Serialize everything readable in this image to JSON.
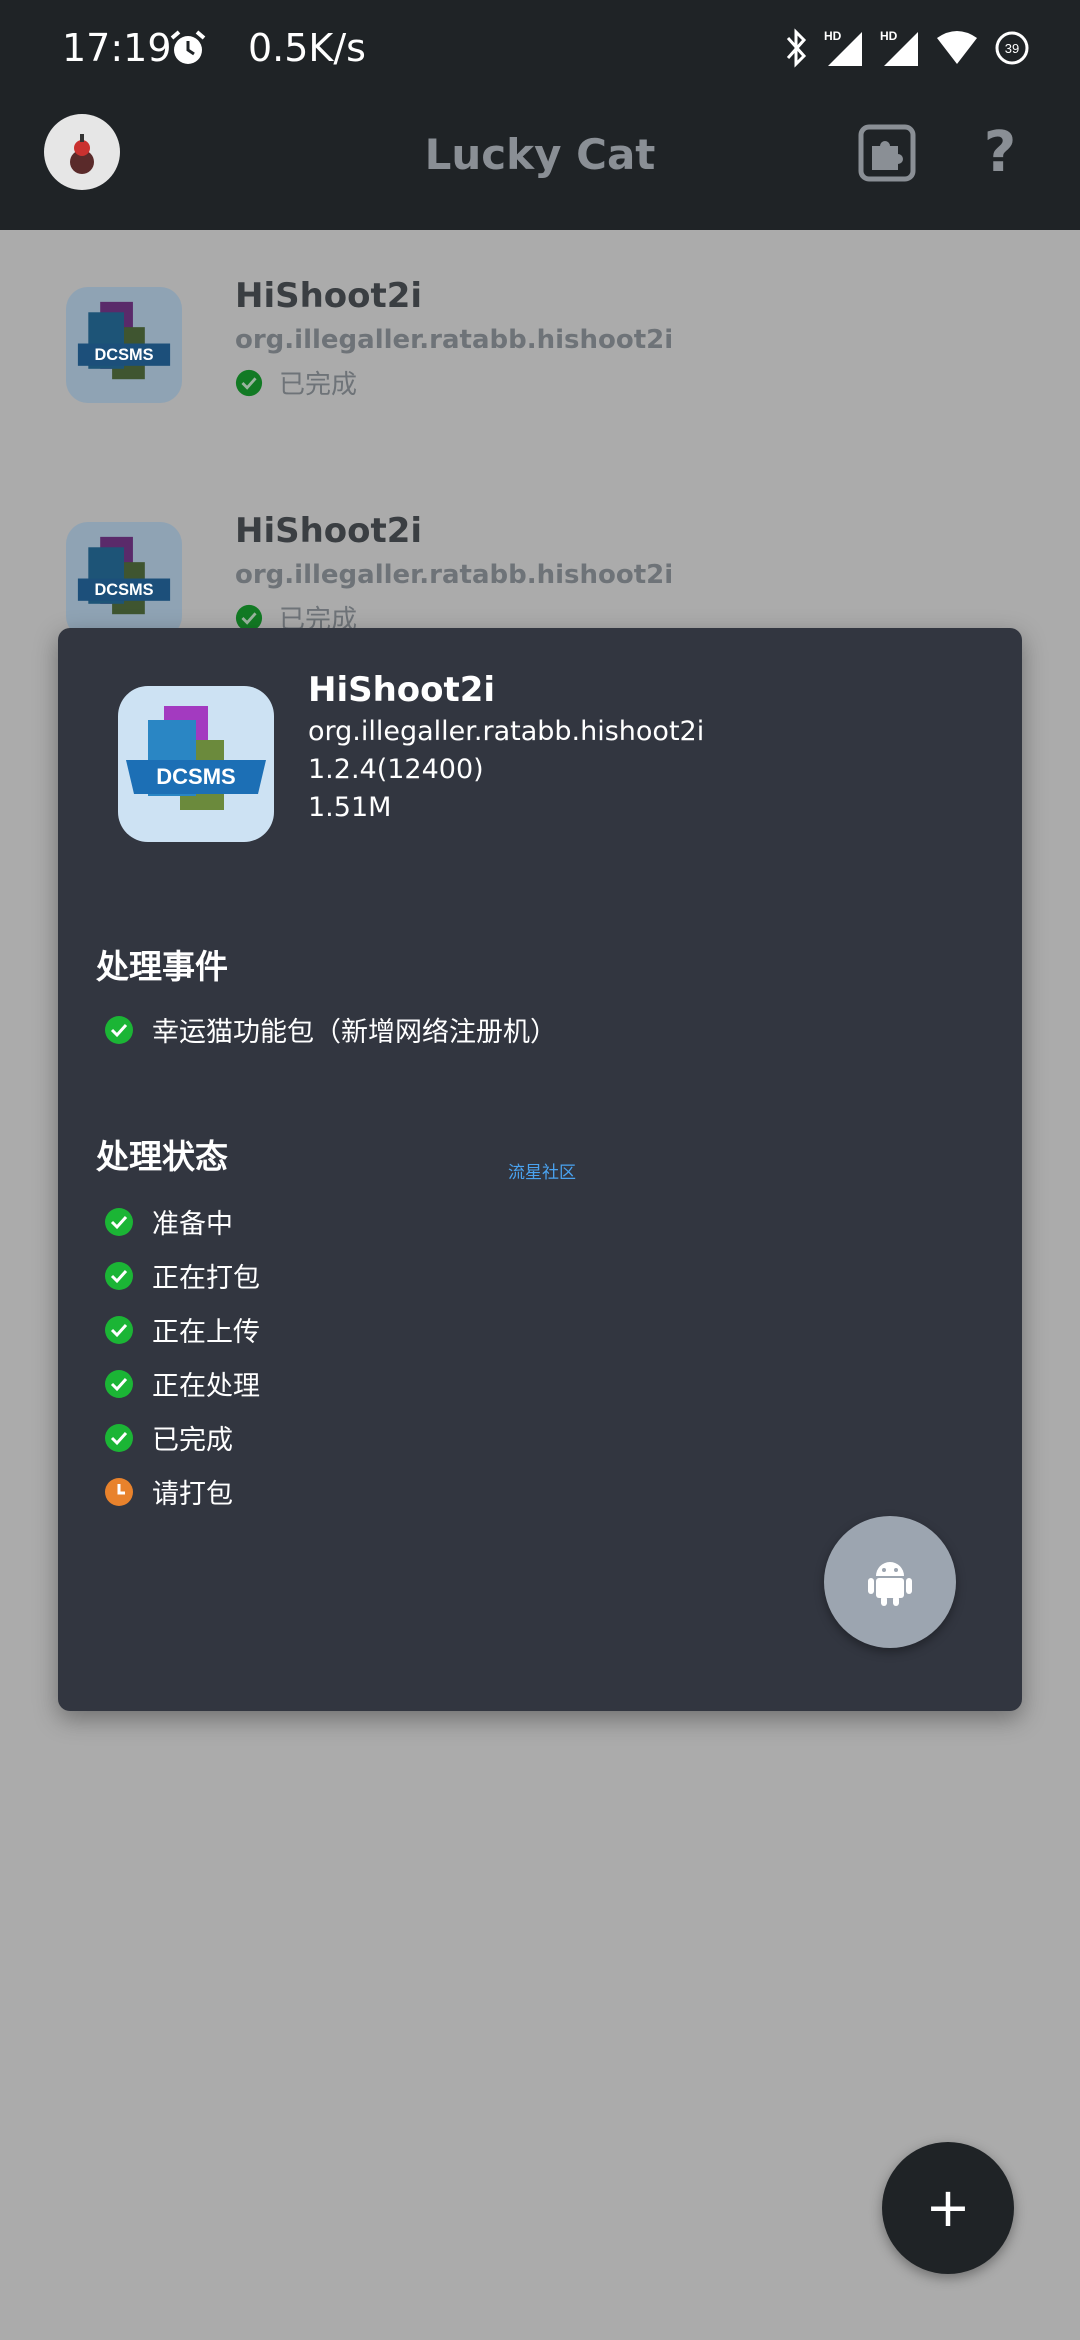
{
  "status_bar": {
    "time": "17:19",
    "net_speed": "0.5K/s",
    "icons": [
      "alarm-icon",
      "bluetooth-icon",
      "hd-signal-icon",
      "hd-signal-icon",
      "wifi-icon",
      "battery-icon"
    ],
    "battery": "39"
  },
  "app_bar": {
    "title": "Lucky Cat",
    "help_label": "?"
  },
  "list": [
    {
      "name": "HiShoot2i",
      "package": "org.illegaller.ratabb.hishoot2i",
      "status": "已完成"
    },
    {
      "name": "HiShoot2i",
      "package": "org.illegaller.ratabb.hishoot2i",
      "status": "已完成"
    }
  ],
  "dialog": {
    "app_name": "HiShoot2i",
    "package": "org.illegaller.ratabb.hishoot2i",
    "version": "1.2.4(12400)",
    "size": "1.51M",
    "icon_text": "DCSMS",
    "events_title": "处理事件",
    "events": [
      "幸运猫功能包（新增网络注册机）"
    ],
    "status_title": "处理状态",
    "statuses": [
      {
        "label": "准备中",
        "state": "done"
      },
      {
        "label": "正在打包",
        "state": "done"
      },
      {
        "label": "正在上传",
        "state": "done"
      },
      {
        "label": "正在处理",
        "state": "done"
      },
      {
        "label": "已完成",
        "state": "done"
      },
      {
        "label": "请打包",
        "state": "pending"
      }
    ],
    "watermark": "流星社区"
  },
  "fab": {
    "label": "+"
  },
  "colors": {
    "done": "#1bb535",
    "pending": "#e8822c",
    "dialog_bg": "#323640",
    "bar_bg": "#1f2326"
  }
}
